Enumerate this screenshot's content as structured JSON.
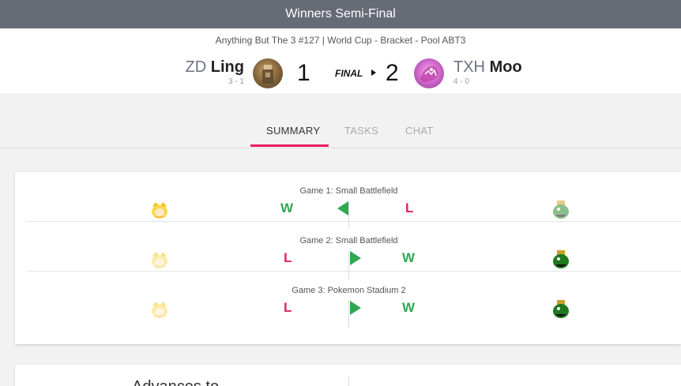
{
  "topbar": {
    "title": "Winners Semi-Final"
  },
  "match": {
    "subtitle": "Anything But The 3 #127 | World Cup - Bracket - Pool ABT3",
    "left": {
      "tag": "ZD",
      "name": "Ling",
      "record": "3 - 1",
      "score": "1"
    },
    "right": {
      "tag": "TXH",
      "name": "Moo",
      "record": "4 - 0",
      "score": "2"
    },
    "status": "FINAL"
  },
  "tabs": [
    {
      "label": "SUMMARY",
      "active": true
    },
    {
      "label": "TASKS",
      "active": false
    },
    {
      "label": "CHAT",
      "active": false
    }
  ],
  "games": [
    {
      "title": "Game 1: Small Battlefield",
      "left_result": "W",
      "right_result": "L",
      "winner": "left",
      "left_char": "peach-icon",
      "right_char": "king-k-rool-icon",
      "left_faded": false,
      "right_faded": true
    },
    {
      "title": "Game 2: Small Battlefield",
      "left_result": "L",
      "right_result": "W",
      "winner": "right",
      "left_char": "peach-icon",
      "right_char": "king-k-rool-icon",
      "left_faded": true,
      "right_faded": false
    },
    {
      "title": "Game 3: Pokemon Stadium 2",
      "left_result": "L",
      "right_result": "W",
      "winner": "right",
      "left_char": "peach-icon",
      "right_char": "king-k-rool-icon",
      "left_faded": true,
      "right_faded": false
    }
  ],
  "advances": {
    "label": "Advances to"
  },
  "colors": {
    "topbar": "#666b75",
    "accent": "#e91e63",
    "win": "#2fa84f",
    "loss": "#e0245e"
  }
}
